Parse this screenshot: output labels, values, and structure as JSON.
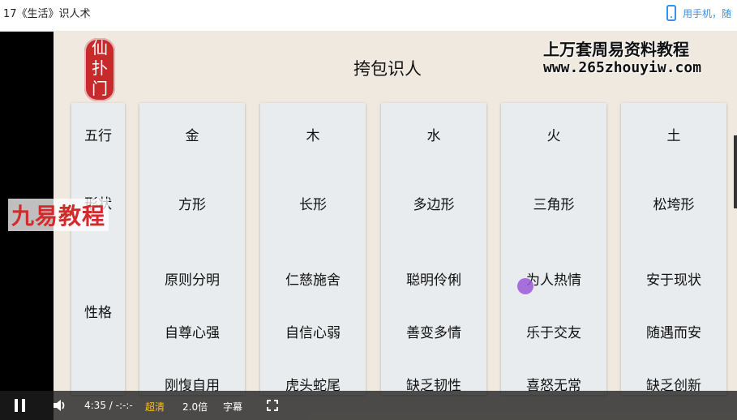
{
  "window": {
    "title": "17《生活》识人术"
  },
  "header": {
    "phone_label": "用手机，随"
  },
  "slide": {
    "seal": "仙\n扑\n门",
    "title": "挎包识人",
    "promo_line1": "上万套周易资料教程",
    "promo_line2": "www.265zhouyiw.com",
    "watermark": "九易教程"
  },
  "table": {
    "row_labels": [
      "五行",
      "形状",
      "性格"
    ],
    "columns": [
      {
        "element": "金",
        "shape": "方形",
        "traits": [
          "原则分明",
          "自尊心强",
          "刚愎自用"
        ]
      },
      {
        "element": "木",
        "shape": "长形",
        "traits": [
          "仁慈施舍",
          "自信心弱",
          "虎头蛇尾"
        ]
      },
      {
        "element": "水",
        "shape": "多边形",
        "traits": [
          "聪明伶俐",
          "善变多情",
          "缺乏韧性"
        ]
      },
      {
        "element": "火",
        "shape": "三角形",
        "traits": [
          "为人热情",
          "乐于交友",
          "喜怒无常"
        ]
      },
      {
        "element": "土",
        "shape": "松垮形",
        "traits": [
          "安于现状",
          "随遇而安",
          "缺乏创新"
        ]
      }
    ]
  },
  "player": {
    "time": "4:35 / -:-:-",
    "quality": "超清",
    "speed": "2.0倍",
    "subtitle": "字幕"
  }
}
